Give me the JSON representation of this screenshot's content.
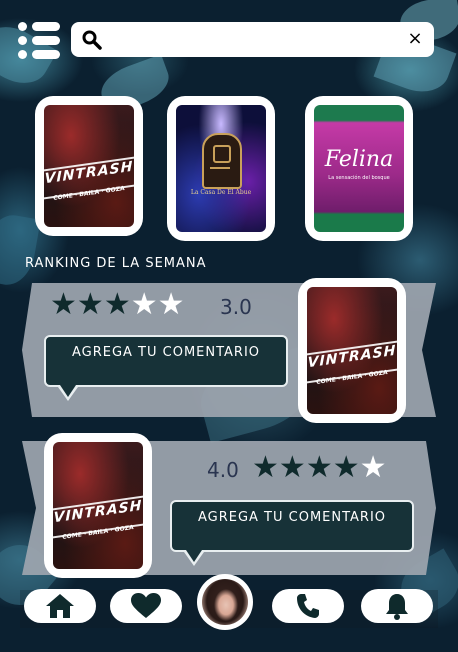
{
  "search": {
    "placeholder": "",
    "value": "",
    "clear_glyph": "×",
    "search_icon": "magnifier-icon"
  },
  "featured": [
    {
      "name": "VINTRASH",
      "tagline": "COME · BAILA · GOZA"
    },
    {
      "name": "La Casa De El Abue",
      "tagline": ""
    },
    {
      "name": "Felina",
      "tagline": "La sensación del bosque"
    }
  ],
  "ranking": {
    "title": "RANKING DE LA SEMANA",
    "entries": [
      {
        "venue": "VINTRASH",
        "tagline": "COME · BAILA · GOZA",
        "rating": 3.0,
        "rating_label": "3.0",
        "comment_label": "AGREGA TU COMENTARIO"
      },
      {
        "venue": "VINTRASH",
        "tagline": "COME · BAILA · GOZA",
        "rating": 4.0,
        "rating_label": "4.0",
        "comment_label": "AGREGA TU COMENTARIO"
      }
    ]
  },
  "nav": {
    "items": [
      "home-icon",
      "heart-icon",
      "profile-avatar",
      "phone-icon",
      "bell-icon"
    ]
  },
  "colors": {
    "card_gray": "#9da5ae",
    "star_dark": "#0f2a2c",
    "button_bg": "#173238"
  }
}
